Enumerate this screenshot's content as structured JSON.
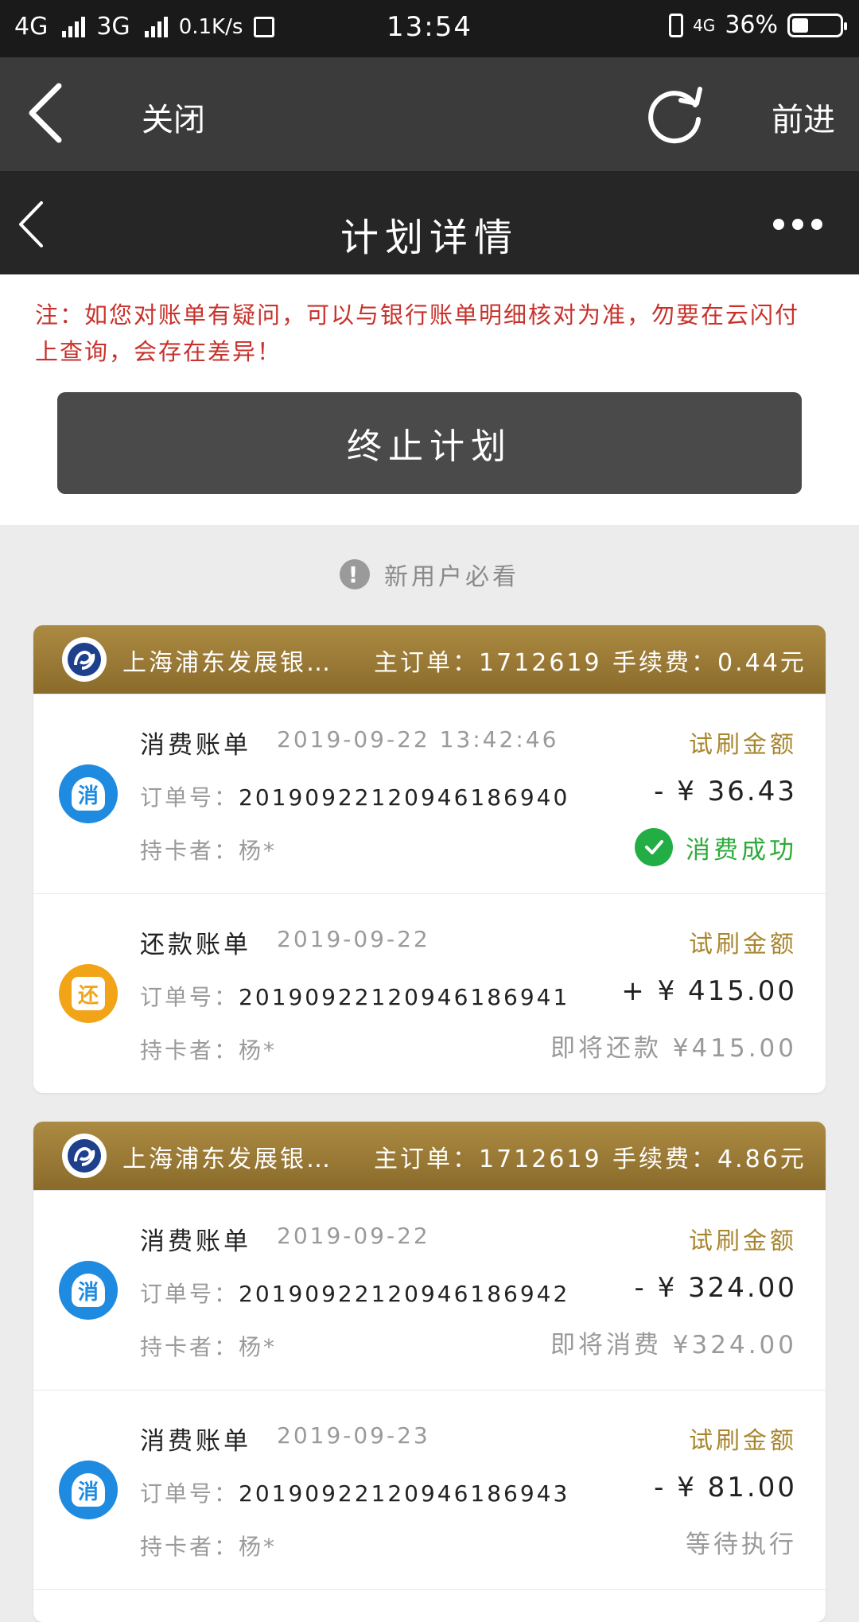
{
  "status_bar": {
    "net1": "4G",
    "net2": "3G",
    "speed": "0.1K/s",
    "time": "13:54",
    "net3": "4G",
    "battery": "36%",
    "battery_level": 0.36
  },
  "browser": {
    "close_label": "关闭",
    "forward_label": "前进"
  },
  "header": {
    "title": "计划详情"
  },
  "notice": "注：如您对账单有疑问，可以与银行账单明细核对为准，勿要在云闪付上查询，会存在差异！",
  "stop_button": "终止计划",
  "guide_label": "新用户必看",
  "plans": [
    {
      "bank": "上海浦东发展银…",
      "order": "主订单：1712619",
      "fee": "手续费：0.44元",
      "bills": [
        {
          "icon_text": "消",
          "icon_color": "#1e8ae0",
          "type": "消费账单",
          "date": "2019-09-22 13:42:46",
          "order_label": "订单号：",
          "order_no": "201909221209461869​40",
          "holder": "持卡者：杨*",
          "trial": "试刷金额",
          "amount": "- ¥ 36.43",
          "status": "消费成功"
        },
        {
          "icon_text": "还",
          "icon_color": "#f2a419",
          "type": "还款账单",
          "date": "2019-09-22",
          "order_label": "订单号：",
          "order_no": "20190922120946186941",
          "holder": "持卡者：杨*",
          "trial": "试刷金额",
          "amount": "+ ¥ 415.00",
          "status": "即将还款 ¥415.00"
        }
      ]
    },
    {
      "bank": "上海浦东发展银…",
      "order": "主订单：1712619",
      "fee": "手续费：4.86元",
      "bills": [
        {
          "icon_text": "消",
          "icon_color": "#1e8ae0",
          "type": "消费账单",
          "date": "2019-09-22",
          "order_label": "订单号：",
          "order_no": "20190922120946186942",
          "holder": "持卡者：杨*",
          "trial": "试刷金额",
          "amount": "- ¥ 324.00",
          "status": "即将消费 ¥324.00"
        },
        {
          "icon_text": "消",
          "icon_color": "#1e8ae0",
          "type": "消费账单",
          "date": "2019-09-23",
          "order_label": "订单号：",
          "order_no": "20190922120946186943",
          "holder": "持卡者：杨*",
          "trial": "试刷金额",
          "amount": "- ¥ 81.00",
          "status": "等待执行"
        }
      ]
    }
  ]
}
